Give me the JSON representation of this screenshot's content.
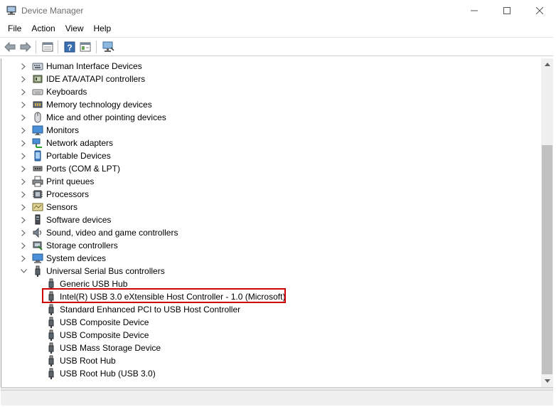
{
  "window": {
    "title": "Device Manager"
  },
  "menu": {
    "items": [
      "File",
      "Action",
      "View",
      "Help"
    ]
  },
  "toolbar": {
    "buttons": [
      "back-icon",
      "forward-icon",
      "properties-icon",
      "help-icon",
      "show-hidden-icon",
      "scan-hardware-icon"
    ]
  },
  "tree": {
    "categories": [
      {
        "label": "Human Interface Devices",
        "icon": "hid-icon",
        "expanded": false
      },
      {
        "label": "IDE ATA/ATAPI controllers",
        "icon": "ide-controller-icon",
        "expanded": false
      },
      {
        "label": "Keyboards",
        "icon": "keyboard-icon",
        "expanded": false
      },
      {
        "label": "Memory technology devices",
        "icon": "memory-icon",
        "expanded": false
      },
      {
        "label": "Mice and other pointing devices",
        "icon": "mouse-icon",
        "expanded": false
      },
      {
        "label": "Monitors",
        "icon": "monitor-icon",
        "expanded": false
      },
      {
        "label": "Network adapters",
        "icon": "network-adapter-icon",
        "expanded": false
      },
      {
        "label": "Portable Devices",
        "icon": "portable-device-icon",
        "expanded": false
      },
      {
        "label": "Ports (COM & LPT)",
        "icon": "port-icon",
        "expanded": false
      },
      {
        "label": "Print queues",
        "icon": "printer-icon",
        "expanded": false
      },
      {
        "label": "Processors",
        "icon": "processor-icon",
        "expanded": false
      },
      {
        "label": "Sensors",
        "icon": "sensor-icon",
        "expanded": false
      },
      {
        "label": "Software devices",
        "icon": "software-device-icon",
        "expanded": false
      },
      {
        "label": "Sound, video and game controllers",
        "icon": "speaker-icon",
        "expanded": false
      },
      {
        "label": "Storage controllers",
        "icon": "storage-controller-icon",
        "expanded": false
      },
      {
        "label": "System devices",
        "icon": "system-device-icon",
        "expanded": false
      },
      {
        "label": "Universal Serial Bus controllers",
        "icon": "usb-icon",
        "expanded": true
      }
    ],
    "usb_children": [
      {
        "label": "Generic USB Hub",
        "selected": false
      },
      {
        "label": "Intel(R) USB 3.0 eXtensible Host Controller - 1.0 (Microsoft)",
        "selected": true
      },
      {
        "label": "Standard Enhanced PCI to USB Host Controller",
        "selected": false
      },
      {
        "label": "USB Composite Device",
        "selected": false
      },
      {
        "label": "USB Composite Device",
        "selected": false
      },
      {
        "label": "USB Mass Storage Device",
        "selected": false
      },
      {
        "label": "USB Root Hub",
        "selected": false
      },
      {
        "label": "USB Root Hub (USB 3.0)",
        "selected": false
      }
    ]
  },
  "colors": {
    "highlight": "#d10000",
    "scroll_thumb": "#c1c1c1"
  }
}
